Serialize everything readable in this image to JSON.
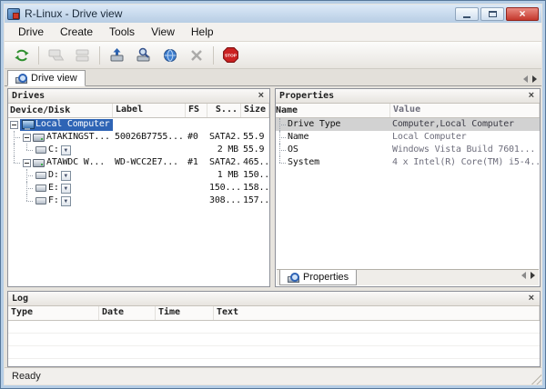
{
  "window": {
    "title": "R-Linux - Drive view",
    "status": "Ready"
  },
  "menu": {
    "items": [
      "Drive",
      "Create",
      "Tools",
      "View",
      "Help"
    ]
  },
  "toolbar": {
    "stop_label": "STOP"
  },
  "main_tab": {
    "label": "Drive view"
  },
  "drives": {
    "title": "Drives",
    "columns": [
      "Device/Disk",
      "Label",
      "FS",
      "S...",
      "Size"
    ],
    "rows": [
      {
        "name": "Local Computer",
        "label": "",
        "fs": "",
        "s": "",
        "size": ""
      },
      {
        "name": "ATAKINGST...",
        "label": "50026B7755...",
        "fs": "#0",
        "s": "SATA2...",
        "size": "55.9 ..."
      },
      {
        "name": "C:",
        "label": "",
        "fs": "",
        "s": "2 MB",
        "size": "55.9 ..."
      },
      {
        "name": "ATAWDC W...",
        "label": "WD-WCC2E7...",
        "fs": "#1",
        "s": "SATA2...",
        "size": "465..."
      },
      {
        "name": "D:",
        "label": "",
        "fs": "",
        "s": "1 MB",
        "size": "150..."
      },
      {
        "name": "E:",
        "label": "",
        "fs": "",
        "s": "150...",
        "size": "158..."
      },
      {
        "name": "F:",
        "label": "",
        "fs": "",
        "s": "308...",
        "size": "157..."
      }
    ]
  },
  "properties": {
    "title": "Properties",
    "tab_label": "Properties",
    "columns": [
      "Name",
      "Value"
    ],
    "rows": [
      {
        "name": "Drive Type",
        "value": "Computer,Local Computer"
      },
      {
        "name": "Name",
        "value": "Local Computer"
      },
      {
        "name": "OS",
        "value": "Windows Vista Build 7601..."
      },
      {
        "name": "System",
        "value": "4 x Intel(R) Core(TM) i5-4..."
      }
    ]
  },
  "log": {
    "title": "Log",
    "columns": [
      "Type",
      "Date",
      "Time",
      "Text"
    ]
  },
  "icons": {
    "close": "×",
    "dropdown": "▼"
  },
  "colors": {
    "selection": "#2e64b5",
    "titlebar": "#bcd0e5",
    "close_button": "#c4372c",
    "stop_sign": "#cc2222",
    "inactive_selection": "#d2d2d2"
  }
}
